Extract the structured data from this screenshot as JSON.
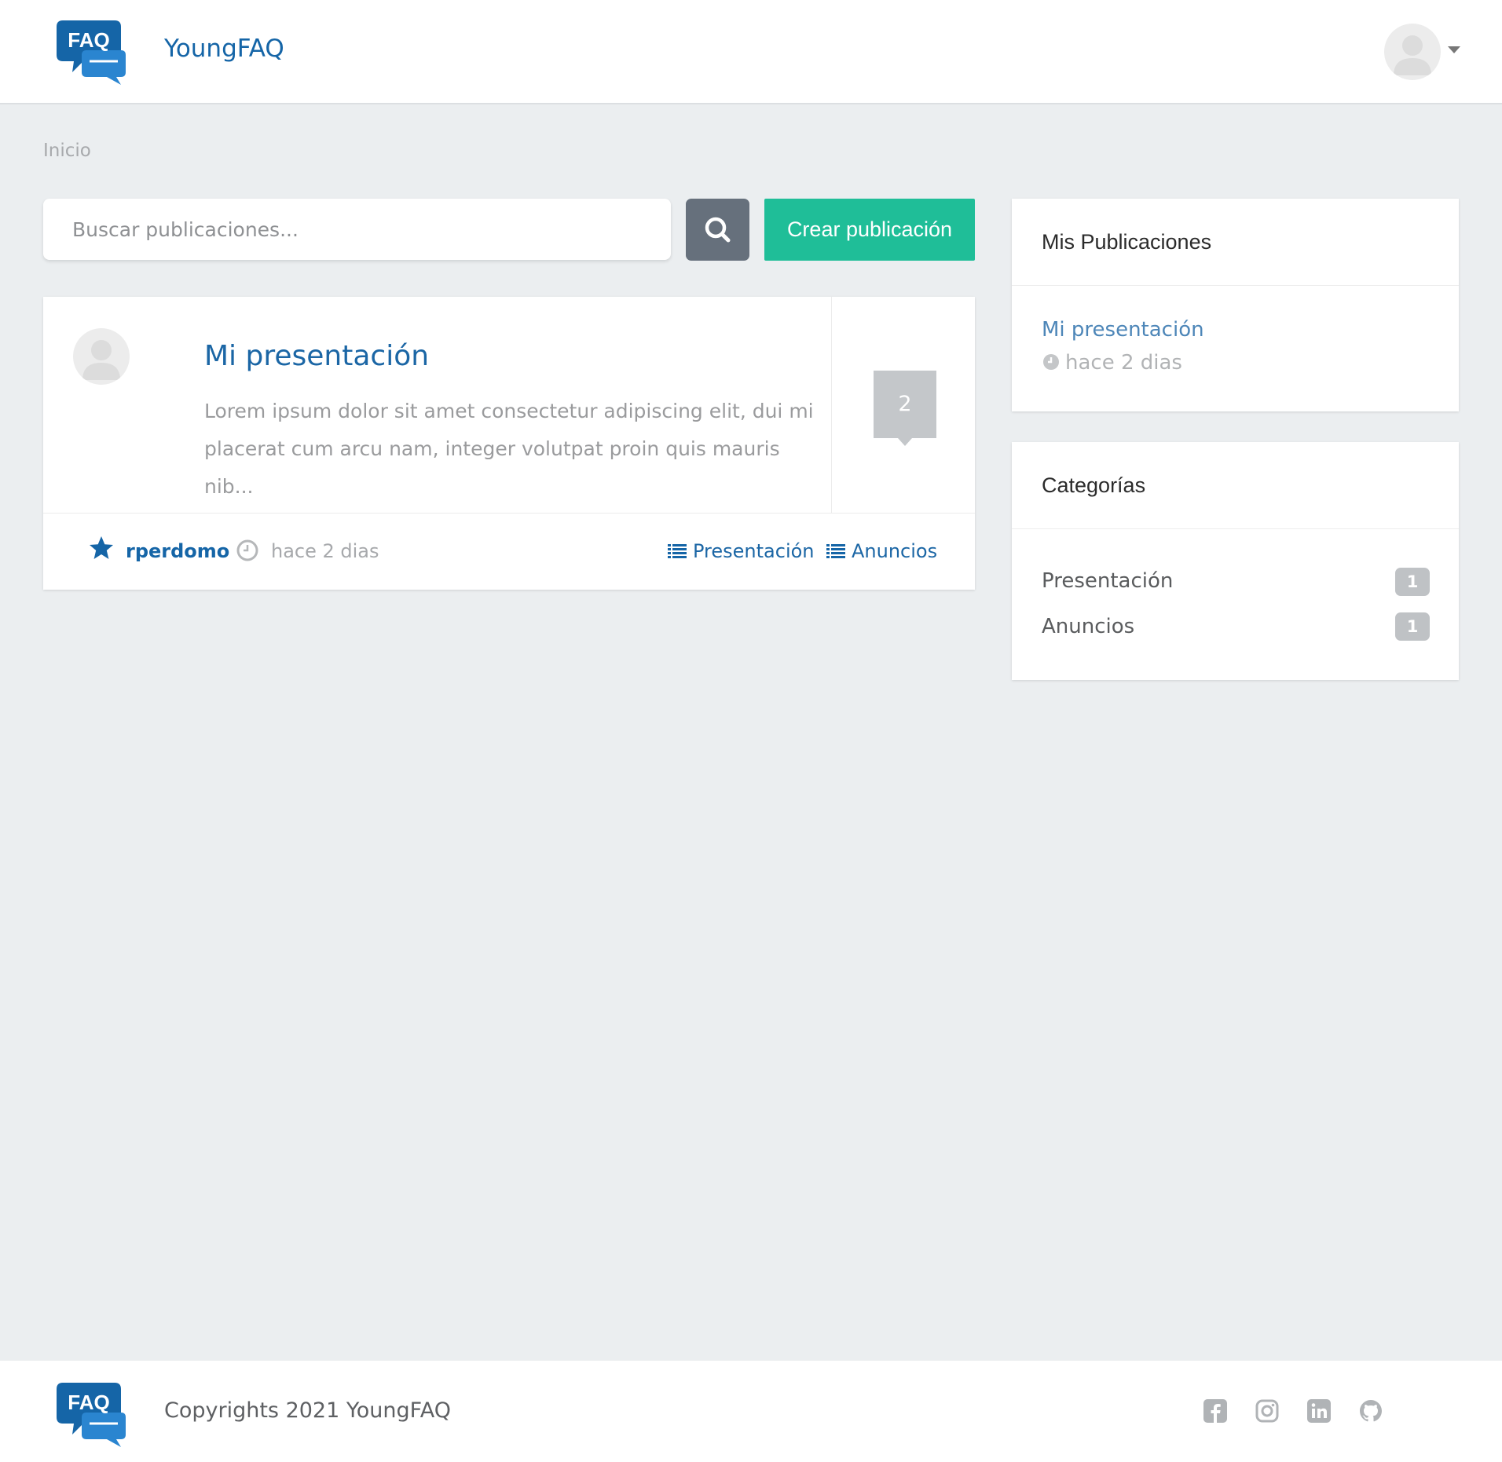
{
  "header": {
    "logo_text": "FAQ",
    "brand": "YoungFAQ"
  },
  "breadcrumb": "Inicio",
  "search": {
    "placeholder": "Buscar publicaciones..."
  },
  "create_button": "Crear publicación",
  "post": {
    "title": "Mi presentación",
    "excerpt": "Lorem ipsum dolor sit amet consectetur adipiscing elit, dui mi placerat cum arcu nam, integer volutpat proin quis mauris nib...",
    "comment_count": "2",
    "author": "rperdomo",
    "time": "hace 2 dias",
    "categories": [
      "Presentación",
      "Anuncios"
    ]
  },
  "my_posts": {
    "title": "Mis Publicaciones",
    "items": [
      {
        "title": "Mi presentación",
        "time": "hace 2 dias"
      }
    ]
  },
  "categories_widget": {
    "title": "Categorías",
    "items": [
      {
        "label": "Presentación",
        "count": "1"
      },
      {
        "label": "Anuncios",
        "count": "1"
      }
    ]
  },
  "footer": {
    "copyright": "Copyrights 2021 YoungFAQ",
    "social_icons": [
      "facebook-icon",
      "instagram-icon",
      "linkedin-icon",
      "github-icon"
    ]
  },
  "colors": {
    "brand_blue": "#1565a7",
    "accent_green": "#1fbe98",
    "search_button": "#66707c",
    "background": "#ebeef0"
  }
}
